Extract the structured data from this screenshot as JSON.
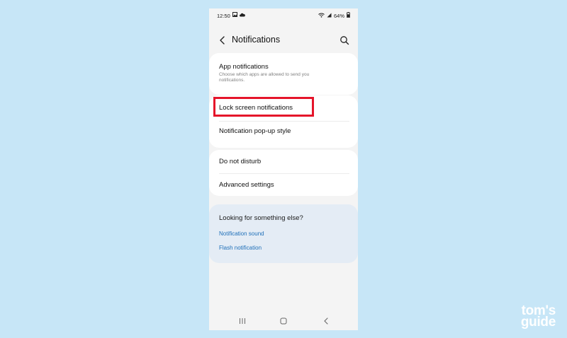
{
  "status_bar": {
    "time": "12:50",
    "left_icons": [
      "image-icon",
      "cloud-icon"
    ],
    "right_icons": [
      "wifi-icon",
      "signal-icon",
      "battery-icon"
    ],
    "battery": "64%"
  },
  "header": {
    "title": "Notifications",
    "back_icon": "back-arrow-icon",
    "search_icon": "search-icon"
  },
  "settings": {
    "app_notifications": {
      "title": "App notifications",
      "subtitle": "Choose which apps are allowed to send you notifications."
    },
    "lock_screen": {
      "title": "Lock screen notifications"
    },
    "popup_style": {
      "title": "Notification pop-up style"
    },
    "do_not_disturb": {
      "title": "Do not disturb"
    },
    "advanced": {
      "title": "Advanced settings"
    }
  },
  "suggestions": {
    "title": "Looking for something else?",
    "links": [
      "Notification sound",
      "Flash notification"
    ]
  },
  "nav_bar": {
    "icons": [
      "recents-icon",
      "home-icon",
      "back-icon"
    ]
  },
  "highlight": {
    "color": "#e5142a",
    "target": "Lock screen notifications"
  },
  "watermark": {
    "line1": "tom's",
    "line2": "guide"
  },
  "colors": {
    "background": "#c7e6f7",
    "link": "#1e6fb8",
    "suggest_card": "#e4ecf5"
  }
}
